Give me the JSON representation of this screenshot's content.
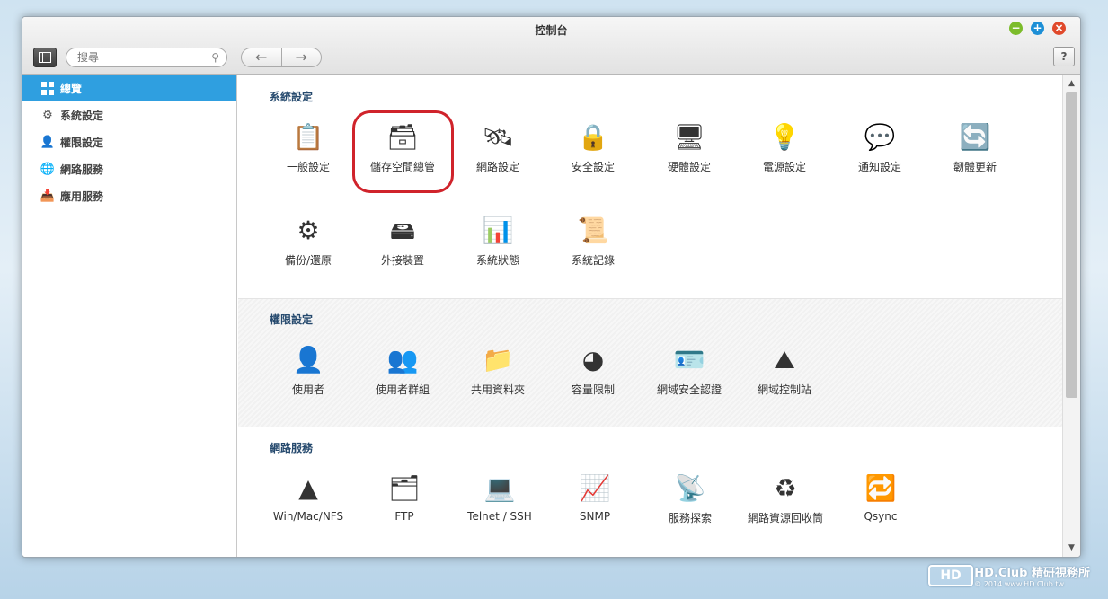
{
  "window": {
    "title": "控制台"
  },
  "toolbar": {
    "search_placeholder": "搜尋",
    "back_glyph": "←",
    "forward_glyph": "→",
    "help_label": "?",
    "minimize_glyph": "−",
    "maximize_glyph": "+",
    "close_glyph": "×"
  },
  "sidebar": {
    "items": [
      {
        "label": "總覽",
        "icon": "grid-icon",
        "active": true
      },
      {
        "label": "系統設定",
        "icon": "gear-icon"
      },
      {
        "label": "權限設定",
        "icon": "user-icon"
      },
      {
        "label": "網路服務",
        "icon": "globe-icon"
      },
      {
        "label": "應用服務",
        "icon": "inbox-icon"
      }
    ]
  },
  "sections": [
    {
      "title": "系統設定",
      "items": [
        {
          "label": "一般設定",
          "icon": "clipboard-gear-icon"
        },
        {
          "label": "儲存空間總管",
          "icon": "disk-stack-icon",
          "highlighted": true
        },
        {
          "label": "網路設定",
          "icon": "network-icon"
        },
        {
          "label": "安全設定",
          "icon": "padlock-icon"
        },
        {
          "label": "硬體設定",
          "icon": "hardware-icon"
        },
        {
          "label": "電源設定",
          "icon": "bulb-icon"
        },
        {
          "label": "通知設定",
          "icon": "chat-bubble-icon"
        },
        {
          "label": "韌體更新",
          "icon": "chip-refresh-icon"
        },
        {
          "label": "備份/還原",
          "icon": "gear-disc-icon"
        },
        {
          "label": "外接裝置",
          "icon": "external-drive-icon"
        },
        {
          "label": "系統狀態",
          "icon": "monitor-icon"
        },
        {
          "label": "系統記錄",
          "icon": "log-icon"
        }
      ]
    },
    {
      "title": "權限設定",
      "items": [
        {
          "label": "使用者",
          "icon": "user-icon"
        },
        {
          "label": "使用者群組",
          "icon": "user-group-icon"
        },
        {
          "label": "共用資料夾",
          "icon": "shared-folder-icon"
        },
        {
          "label": "容量限制",
          "icon": "quota-pie-icon"
        },
        {
          "label": "網域安全認證",
          "icon": "id-card-icon"
        },
        {
          "label": "網域控制站",
          "icon": "domain-controller-icon"
        }
      ]
    },
    {
      "title": "網路服務",
      "items": [
        {
          "label": "Win/Mac/NFS",
          "icon": "os-icon"
        },
        {
          "label": "FTP",
          "icon": "ftp-server-icon"
        },
        {
          "label": "Telnet / SSH",
          "icon": "terminal-icon"
        },
        {
          "label": "SNMP",
          "icon": "bar-chart-icon"
        },
        {
          "label": "服務探索",
          "icon": "satellite-icon"
        },
        {
          "label": "網路資源回收筒",
          "icon": "recycle-bin-icon"
        },
        {
          "label": "Qsync",
          "icon": "sync-icon"
        }
      ]
    }
  ],
  "watermark": {
    "logo": "HD",
    "line1": "HD.Club 精研視務所",
    "line2": "© 2014  www.HD.Club.tw"
  }
}
